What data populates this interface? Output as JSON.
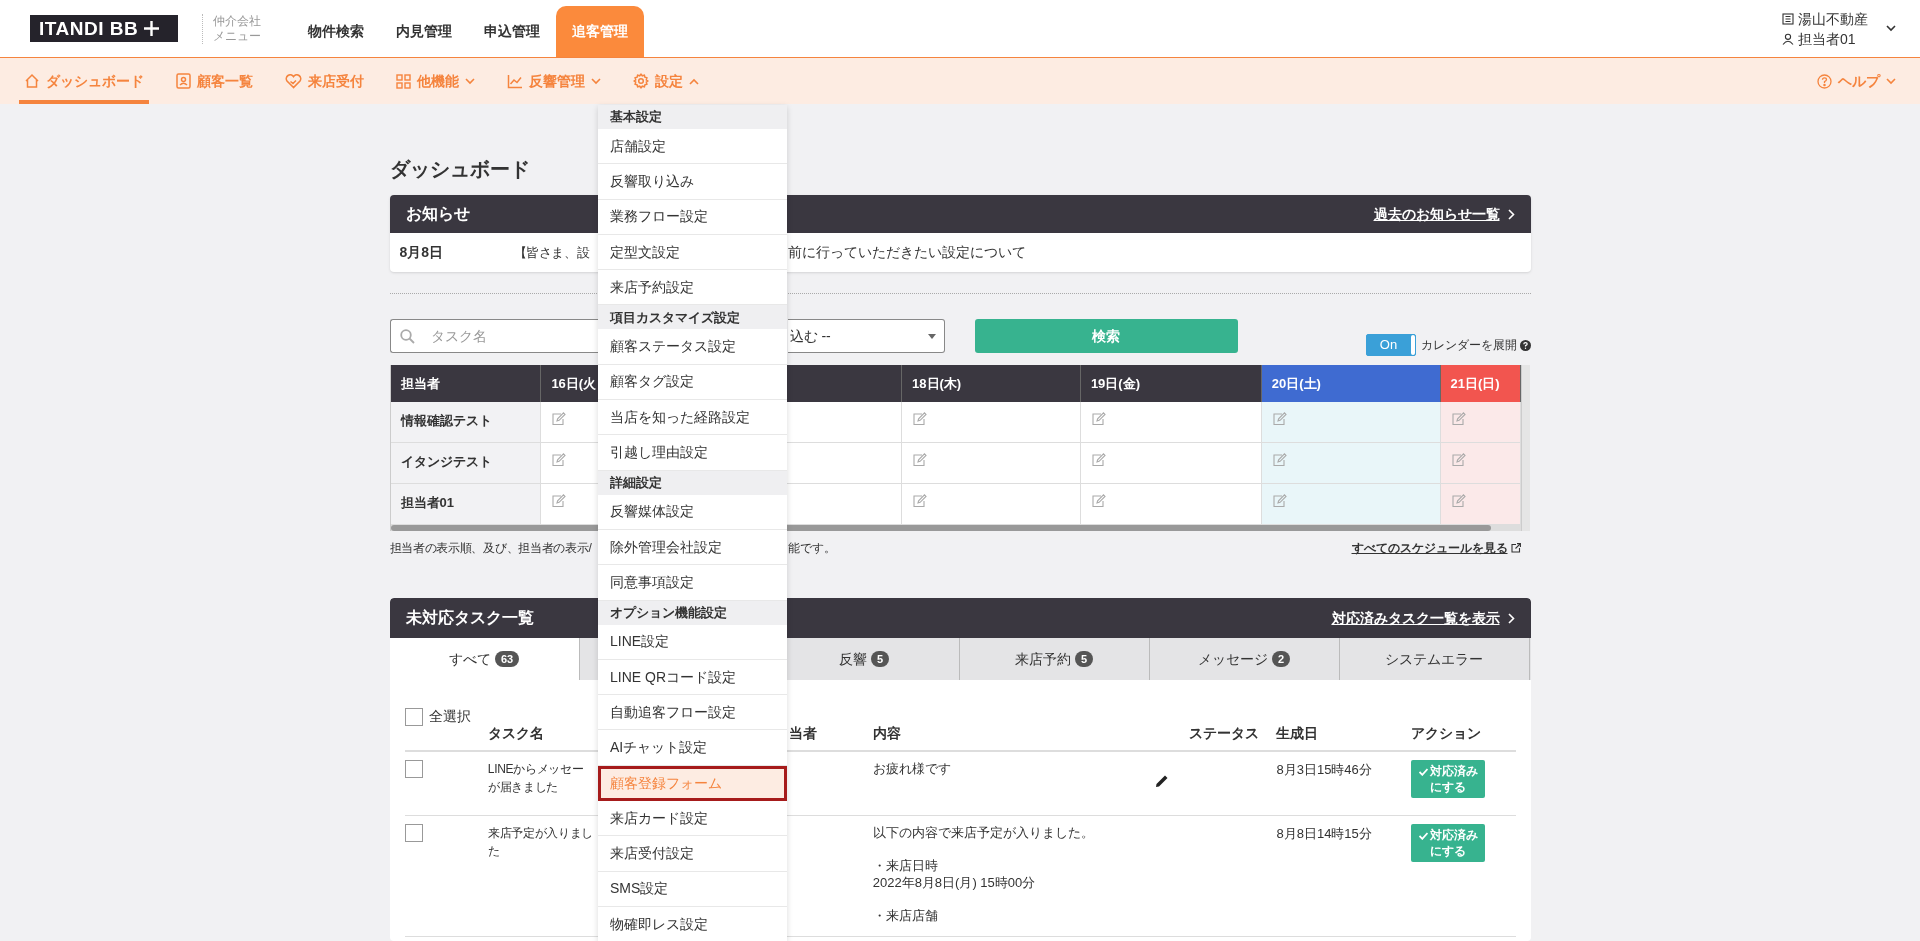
{
  "header": {
    "logo": "ITANDI BB",
    "sublabel_lines": [
      "仲介会社",
      "メニュー"
    ],
    "nav": [
      {
        "label": "物件検索",
        "selected": false
      },
      {
        "label": "内見管理",
        "selected": false
      },
      {
        "label": "申込管理",
        "selected": false
      },
      {
        "label": "追客管理",
        "selected": true
      }
    ],
    "account": {
      "company": "湯山不動産",
      "user": "担当者01"
    }
  },
  "subnav": {
    "items": [
      {
        "kind": "link",
        "label": "ダッシュボード",
        "selected": true
      },
      {
        "kind": "link",
        "label": "顧客一覧",
        "selected": false
      },
      {
        "kind": "link",
        "label": "来店受付",
        "selected": false
      },
      {
        "kind": "dropdown",
        "label": "他機能",
        "selected": false,
        "expanded": false
      },
      {
        "kind": "dropdown",
        "label": "反響管理",
        "selected": false,
        "expanded": false
      },
      {
        "kind": "dropdown",
        "label": "設定",
        "selected": false,
        "expanded": true
      }
    ],
    "help": "ヘルプ"
  },
  "page_title": "ダッシュボード",
  "notices": {
    "title": "お知らせ",
    "link": "過去のお知らせ一覧",
    "rows": [
      {
        "date": "8月8日",
        "text_parts": [
          "【皆さま、設",
          "前に行っていただきたい設定について"
        ]
      }
    ]
  },
  "search": {
    "placeholder": "タスク名",
    "select_value": "込む --",
    "button": "検索",
    "calendar_toggle": {
      "label": "On",
      "on": true,
      "caption": "カレンダーを展開"
    }
  },
  "calendar": {
    "first_column": "担当者",
    "columns": [
      {
        "label": "16日(火",
        "kind": "weekday"
      },
      {
        "label": "18日(木)",
        "kind": "weekday"
      },
      {
        "label": "19日(金)",
        "kind": "weekday"
      },
      {
        "label": "20日(土)",
        "kind": "saturday"
      },
      {
        "label": "21日(日)",
        "kind": "sunday"
      }
    ],
    "rows": [
      "情報確認テスト",
      "イタンジテスト",
      "担当者01"
    ],
    "note_parts": [
      "担当者の表示順、及び、担当者の表示/",
      "能です。"
    ],
    "link": "すべてのスケジュールを見る"
  },
  "tasks": {
    "title": "未対応タスク一覧",
    "link": "対応済みタスク一覧を表示",
    "tabs": [
      {
        "label": "すべて",
        "count": "63",
        "selected": true
      },
      {
        "label": "反響",
        "count": "5",
        "selected": false
      },
      {
        "label": "来店予約",
        "count": "5",
        "selected": false
      },
      {
        "label": "メッセージ",
        "count": "2",
        "selected": false
      },
      {
        "label": "システムエラー",
        "selected": false
      }
    ],
    "select_all": {
      "label": "全選択",
      "checked": false
    },
    "columns": [
      "タスク名",
      "当者",
      "内容",
      "ステータス",
      "生成日",
      "アクション"
    ],
    "rows": [
      {
        "checked": false,
        "name_lines": [
          "LINEからメッセー",
          "が届きました"
        ],
        "content": [
          [
            "お疲れ様です"
          ]
        ],
        "edit_icon": true,
        "created": "8月3日15時46分",
        "action": "対応済みにする"
      },
      {
        "checked": false,
        "name_lines": [
          "来店予定が入りまし",
          "た"
        ],
        "content": [
          [
            "以下の内容で来店予定が入りました。"
          ],
          [
            "・来店日時",
            "2022年8月8日(月) 15時00分"
          ],
          [
            "・来店店舗"
          ]
        ],
        "edit_icon": false,
        "created": "8月8日14時15分",
        "action": "対応済みにする"
      }
    ]
  },
  "settings_menu": {
    "sections": [
      {
        "title": "基本設定",
        "items": [
          {
            "label": "店舗設定",
            "selected": false
          },
          {
            "label": "反響取り込み",
            "selected": false
          },
          {
            "label": "業務フロー設定",
            "selected": false
          },
          {
            "label": "定型文設定",
            "selected": false
          },
          {
            "label": "来店予約設定",
            "selected": false
          }
        ]
      },
      {
        "title": "項目カスタマイズ設定",
        "items": [
          {
            "label": "顧客ステータス設定",
            "selected": false
          },
          {
            "label": "顧客タグ設定",
            "selected": false
          },
          {
            "label": "当店を知った経路設定",
            "selected": false
          },
          {
            "label": "引越し理由設定",
            "selected": false
          }
        ]
      },
      {
        "title": "詳細設定",
        "items": [
          {
            "label": "反響媒体設定",
            "selected": false
          },
          {
            "label": "除外管理会社設定",
            "selected": false
          },
          {
            "label": "同意事項設定",
            "selected": false
          }
        ]
      },
      {
        "title": "オプション機能設定",
        "items": [
          {
            "label": "LINE設定",
            "selected": false
          },
          {
            "label": "LINE QRコード設定",
            "selected": false
          },
          {
            "label": "自動追客フロー設定",
            "selected": false
          },
          {
            "label": "AIチャット設定",
            "selected": false
          },
          {
            "label": "顧客登録フォーム",
            "selected": true
          },
          {
            "label": "来店カード設定",
            "selected": false
          },
          {
            "label": "来店受付設定",
            "selected": false
          },
          {
            "label": "SMS設定",
            "selected": false
          },
          {
            "label": "物確即レス設定",
            "selected": false
          }
        ]
      }
    ]
  }
}
